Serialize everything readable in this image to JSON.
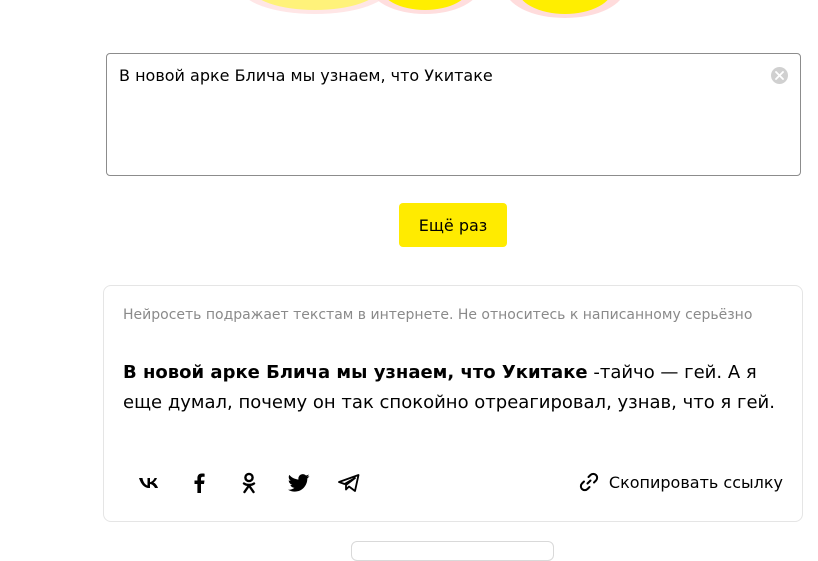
{
  "input": {
    "value": "В новой арке Блича мы узнаем, что Укитаке"
  },
  "buttons": {
    "again_label": "Ещё раз",
    "copy_link_label": "Скопировать ссылку"
  },
  "result": {
    "disclaimer": "Нейросеть подражает текстам в интернете. Не относитесь к написанному серьёзно",
    "prompt_part": "В новой арке Блича мы узнаем, что Укитаке",
    "generated_part": " -тайчо — гей. А я еще думал, почему он так спокойно отреагировал, узнав, что я гей."
  },
  "share": {
    "icons": [
      "vk-icon",
      "facebook-icon",
      "odnoklassniki-icon",
      "twitter-icon",
      "telegram-icon"
    ]
  },
  "colors": {
    "accent": "#ffeb00",
    "border": "#8c8c8c",
    "muted_text": "#8a8a8a"
  }
}
